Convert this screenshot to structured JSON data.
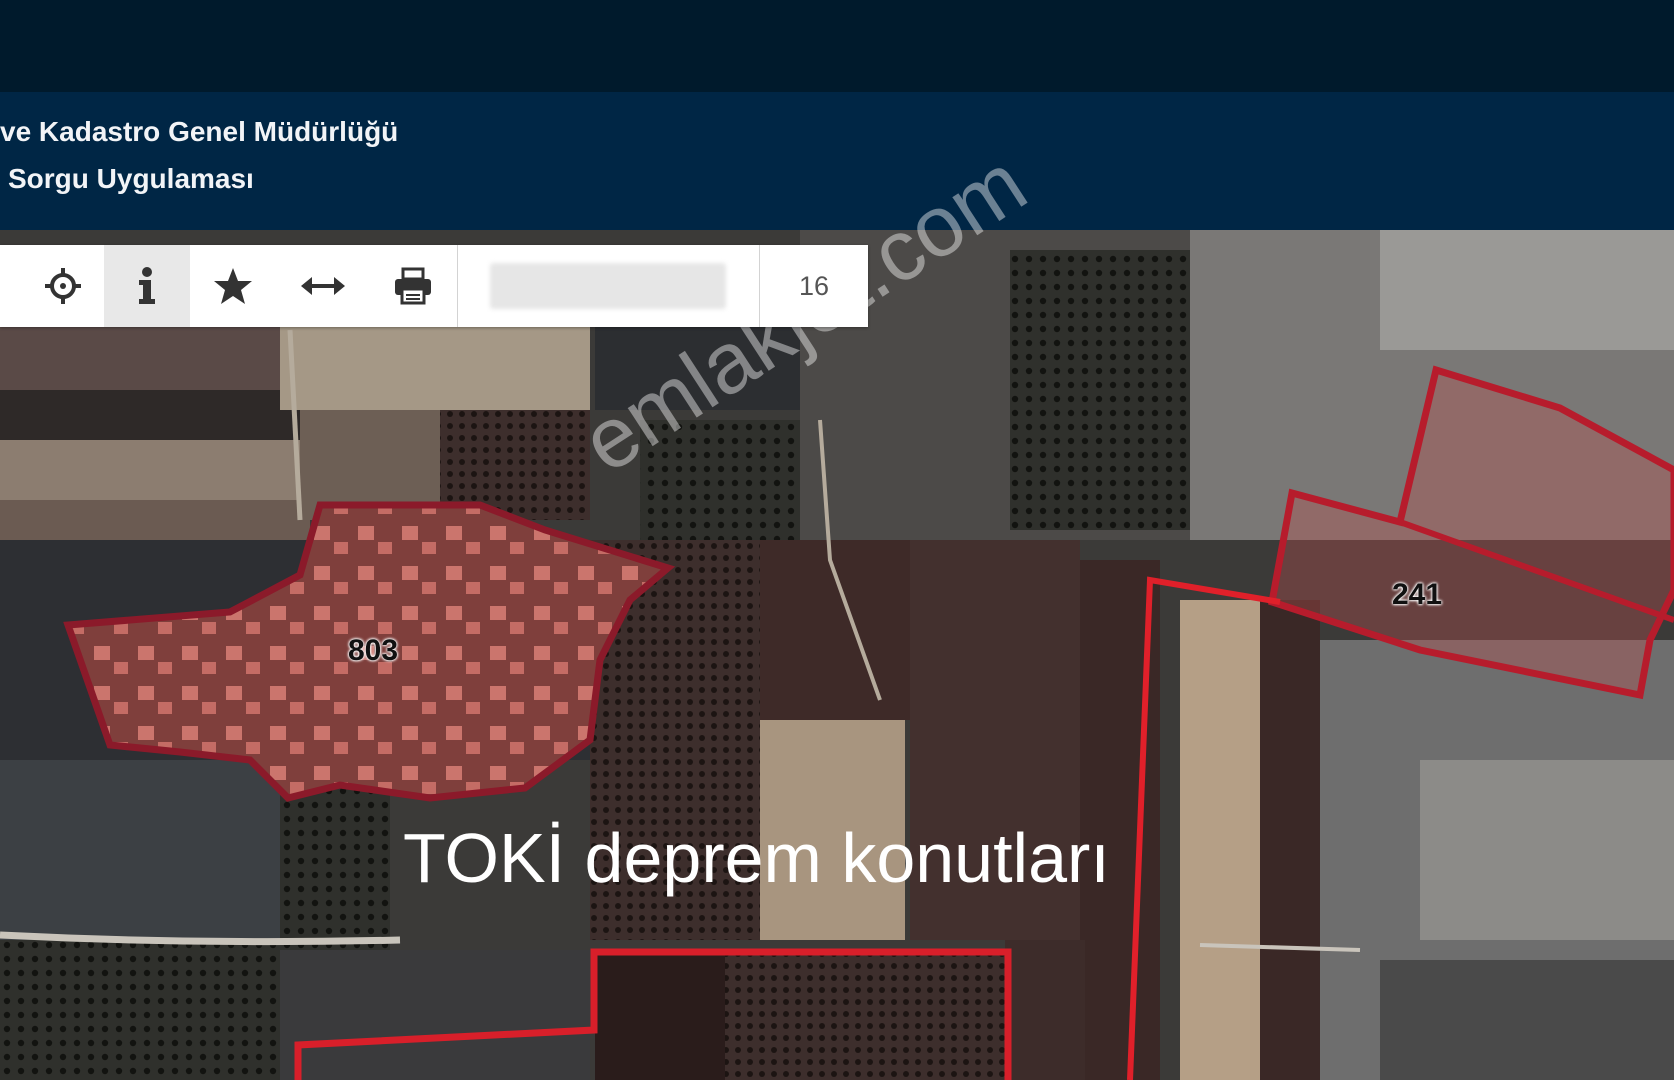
{
  "header": {
    "line1": "ve Kadastro Genel Müdürlüğü",
    "line2": "Sorgu Uygulaması"
  },
  "toolbar": {
    "tools": [
      "crosshair-icon",
      "info-icon",
      "star-icon",
      "measure-icon",
      "print-icon"
    ],
    "active_tool": "info-icon",
    "zoom_level": "16"
  },
  "map": {
    "parcels": [
      {
        "label": "803",
        "style": "filled"
      },
      {
        "label": "241",
        "style": "filled"
      },
      {
        "label": "",
        "style": "outline"
      },
      {
        "label": "",
        "style": "outline"
      }
    ],
    "watermark": "emlakjet.com",
    "caption": "TOKİ deprem konutları",
    "parcel_color": "#8b1a2a",
    "outline_color": "#e0202a"
  }
}
